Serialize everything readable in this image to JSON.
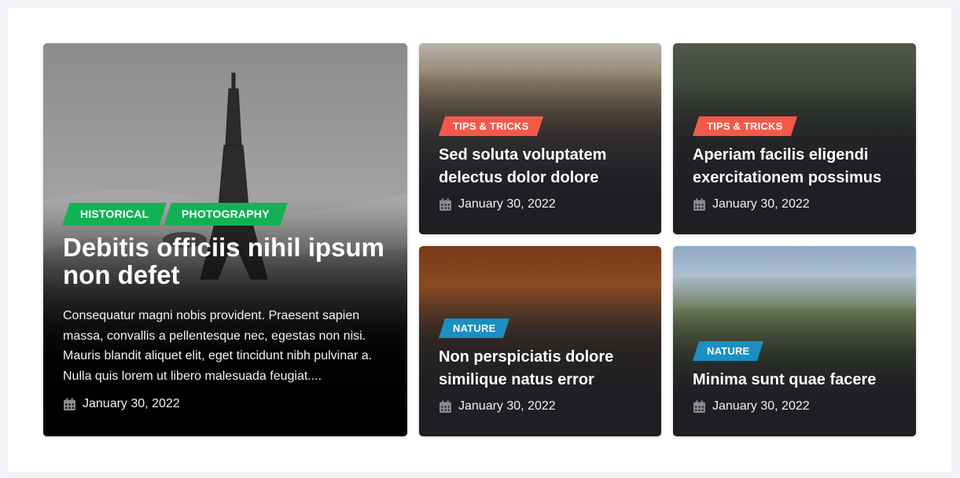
{
  "colors": {
    "historical": "#12b254",
    "photography": "#12b254",
    "tips": "#f2594b",
    "nature": "#1b8fc2"
  },
  "icon": "calendar-icon",
  "featured": {
    "tags": [
      "Historical",
      "Photography"
    ],
    "title": "Debitis officiis nihil ipsum non defet",
    "excerpt": "Consequatur magni nobis provident. Praesent sapien massa, convallis a pellentesque nec, egestas non nisi. Mauris blandit aliquet elit, eget tincidunt nibh pulvinar a. Nulla quis lorem ut libero malesuada feugiat....",
    "date": "January 30, 2022"
  },
  "posts": [
    {
      "tag": "Tips & Tricks",
      "title": "Sed soluta voluptatem delectus dolor dolore",
      "date": "January 30, 2022"
    },
    {
      "tag": "Tips & Tricks",
      "title": "Aperiam facilis eligendi exercitationem possimus",
      "date": "January 30, 2022"
    },
    {
      "tag": "Nature",
      "title": "Non perspiciatis dolore similique natus error",
      "date": "January 30, 2022"
    },
    {
      "tag": "Nature",
      "title": "Minima sunt quae facere",
      "date": "January 30, 2022"
    }
  ]
}
